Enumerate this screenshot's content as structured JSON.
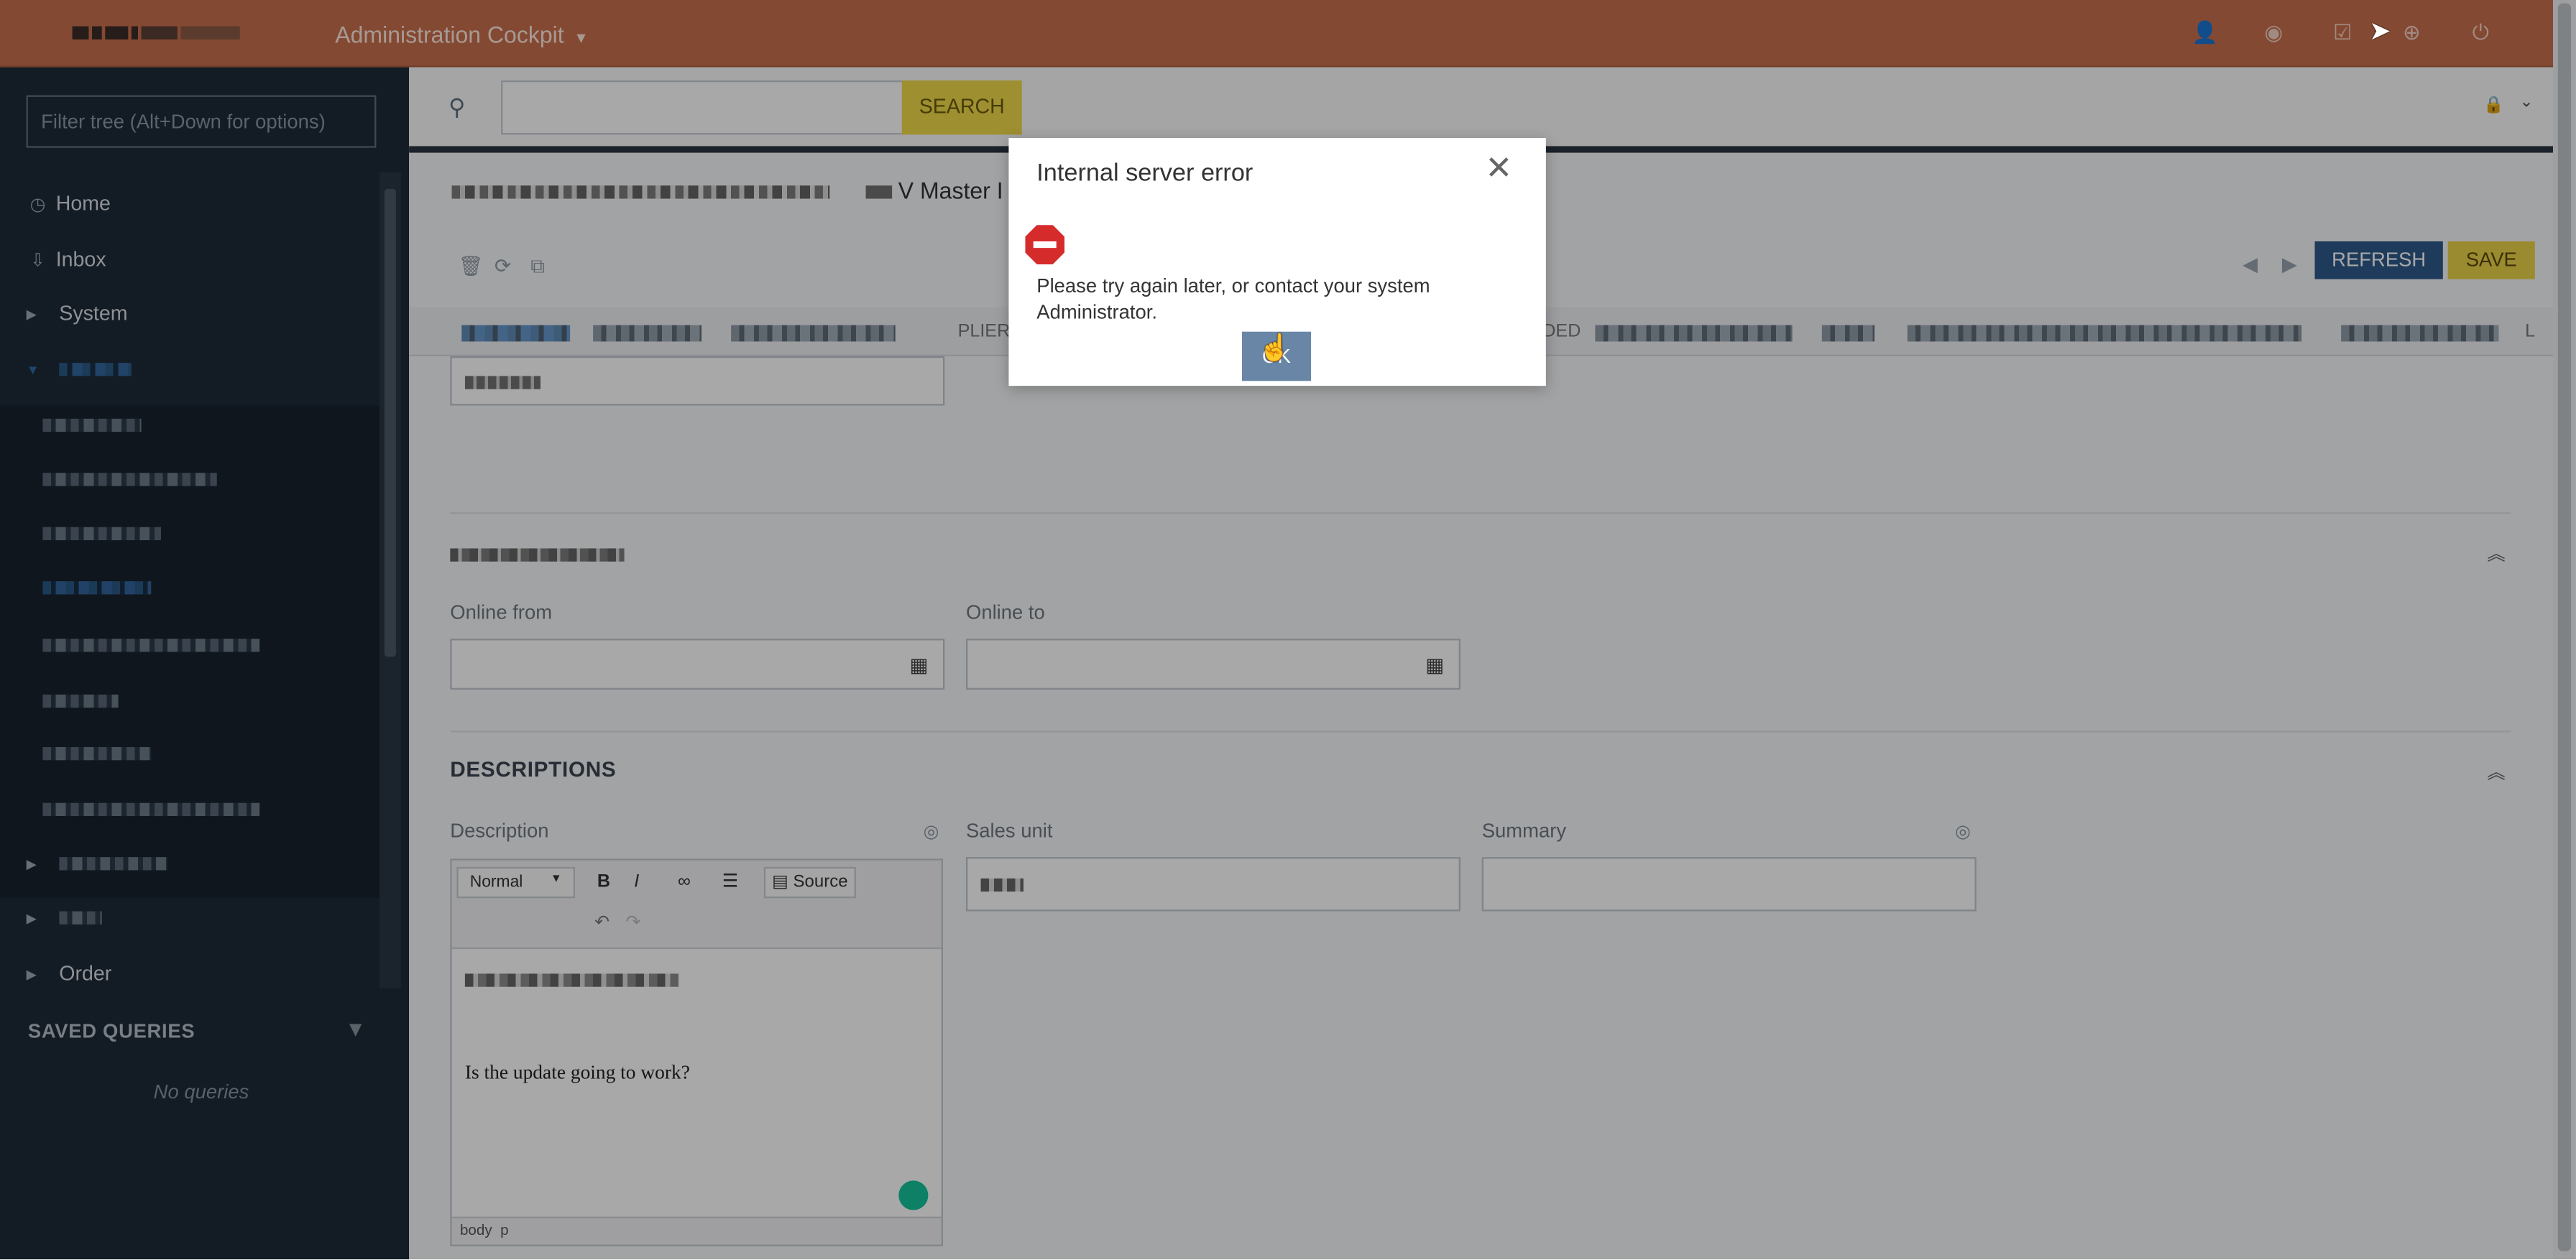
{
  "header": {
    "app_title": "Administration Cockpit",
    "icons": [
      "user-settings-icon",
      "globe-icon",
      "tasks-icon",
      "help-icon",
      "power-icon"
    ]
  },
  "sidebar": {
    "filter_placeholder": "Filter tree (Alt+Down for options)",
    "items": [
      {
        "label": "Home",
        "icon": "home-icon"
      },
      {
        "label": "Inbox",
        "icon": "inbox-icon"
      },
      {
        "label": "System"
      },
      {
        "label": "Order"
      }
    ],
    "saved_queries_title": "SAVED QUERIES",
    "no_queries": "No queries"
  },
  "search": {
    "button_label": "SEARCH"
  },
  "editor": {
    "title_suffix": "V Master I",
    "refresh_label": "REFRESH",
    "save_label": "SAVE",
    "tab_visible_fragments": [
      "PLIER",
      "DED"
    ],
    "tab_trailing": "L"
  },
  "form": {
    "online_from_label": "Online from",
    "online_to_label": "Online to",
    "descriptions_title": "DESCRIPTIONS",
    "description_label": "Description",
    "sales_unit_label": "Sales unit",
    "summary_label": "Summary",
    "rte": {
      "format_select": "Normal",
      "source_label": "Source",
      "content": "Is the update going to work?",
      "path_body": "body",
      "path_p": "p"
    }
  },
  "dialog": {
    "title": "Internal server error",
    "message": "Please try again later, or contact your system Administrator.",
    "ok_label": "OK"
  },
  "colors": {
    "header": "#c8704d",
    "sidebar": "#1d2a37",
    "refresh": "#2e5a8a",
    "save": "#ecd34a",
    "ok": "#6986a7",
    "error": "#d62b2b"
  }
}
